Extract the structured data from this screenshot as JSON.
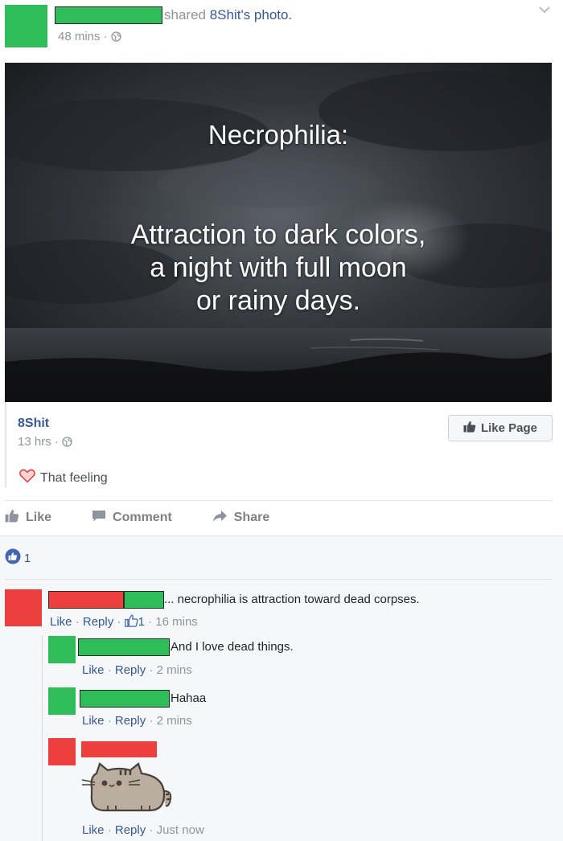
{
  "post": {
    "shared_prefix": "shared ",
    "shared_page": "8Shit's",
    "shared_suffix": " photo.",
    "time": "48 mins",
    "audience_icon": "globe-icon",
    "menu_icon": "chevron-down-icon"
  },
  "photo": {
    "title": "Necrophilia:",
    "body_lines": [
      "Attraction to dark colors,",
      "a night with full moon",
      "or rainy days."
    ]
  },
  "shared_page": {
    "name": "8Shit",
    "time": "13 hrs",
    "like_page_label": "Like Page",
    "feeling": "That feeling"
  },
  "actions": {
    "like": "Like",
    "comment": "Comment",
    "share": "Share"
  },
  "reactions": {
    "count": "1"
  },
  "comments": [
    {
      "text": "... necrophilia is attraction toward dead corpses.",
      "like": "Like",
      "reply": "Reply",
      "likes": "1",
      "time": "16 mins"
    },
    {
      "text": "And I love dead things.",
      "like": "Like",
      "reply": "Reply",
      "time": "2 mins"
    },
    {
      "text": "Hahaa",
      "like": "Like",
      "reply": "Reply",
      "time": "2 mins"
    },
    {
      "sticker": "pusheen-cat-sticker",
      "like": "Like",
      "reply": "Reply",
      "time": "Just now"
    }
  ],
  "colors": {
    "link": "#365899",
    "muted": "#90949c",
    "redact_green": "#2ebd59",
    "redact_red": "#ee3f3f",
    "like_blue": "#4267b2"
  },
  "separators": {
    "dot": "·"
  }
}
